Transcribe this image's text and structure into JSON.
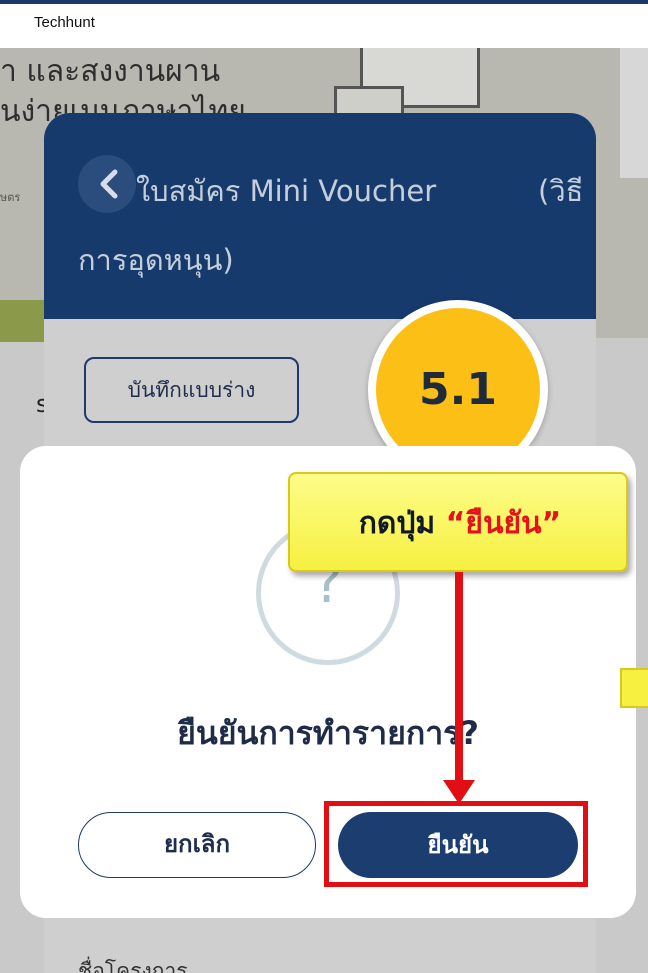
{
  "app": {
    "title": "Techhunt"
  },
  "background": {
    "banner_line1": "ำ และสงงานผาน",
    "banner_line2": "นง่ายเมนภาษาไทย",
    "side_text": "ษตร",
    "side_letter": "s"
  },
  "form": {
    "title_line1": "ใบสมัคร Mini Voucher",
    "title_tail": "(วิธี",
    "title_line2": "การอุดหนุน)",
    "draft_button": "บันทึกแบบร่าง",
    "project_name_label": "ชื่อโครงการ"
  },
  "step_badge": {
    "label": "5.1"
  },
  "dialog": {
    "icon": "question-icon",
    "icon_glyph": "?",
    "title": "ยืนยันการทำรายการ?",
    "cancel_label": "ยกเลิก",
    "confirm_label": "ยืนยัน"
  },
  "callout": {
    "prefix": "กดปุ่ม ",
    "highlight": "“ยืนยัน”"
  },
  "colors": {
    "header_navy": "#173a6c",
    "confirm_button": "#1b3d6f",
    "badge_yellow": "#fbbf15",
    "annotation_red": "#e10f14",
    "callout_yellow": "#f6f040"
  }
}
